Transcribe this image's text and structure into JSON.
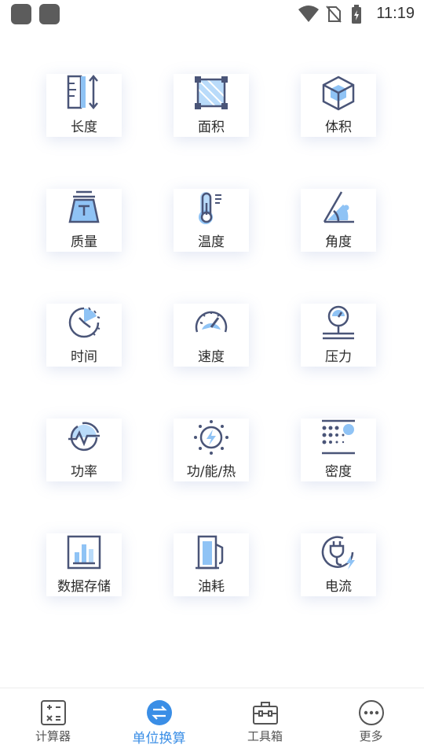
{
  "status_bar": {
    "time": "11:19"
  },
  "tiles": [
    {
      "label": "长度",
      "icon": "ruler-length-icon"
    },
    {
      "label": "面积",
      "icon": "area-square-icon"
    },
    {
      "label": "体积",
      "icon": "volume-cube-icon"
    },
    {
      "label": "质量",
      "icon": "weight-icon"
    },
    {
      "label": "温度",
      "icon": "thermometer-icon"
    },
    {
      "label": "角度",
      "icon": "angle-icon"
    },
    {
      "label": "时间",
      "icon": "clock-icon"
    },
    {
      "label": "速度",
      "icon": "speedometer-icon"
    },
    {
      "label": "压力",
      "icon": "pressure-gauge-icon"
    },
    {
      "label": "功率",
      "icon": "power-pulse-icon"
    },
    {
      "label": "功/能/热",
      "icon": "energy-bolt-icon"
    },
    {
      "label": "密度",
      "icon": "density-dots-icon"
    },
    {
      "label": "数据存储",
      "icon": "bar-chart-storage-icon"
    },
    {
      "label": "油耗",
      "icon": "fuel-pump-icon"
    },
    {
      "label": "电流",
      "icon": "plug-current-icon"
    }
  ],
  "bottom_nav": [
    {
      "label": "计算器",
      "icon": "calculator-icon",
      "active": false
    },
    {
      "label": "单位换算",
      "icon": "convert-arrows-icon",
      "active": true
    },
    {
      "label": "工具箱",
      "icon": "toolbox-icon",
      "active": false
    },
    {
      "label": "更多",
      "icon": "more-dots-icon",
      "active": false
    }
  ],
  "colors": {
    "accent": "#3a8ee6",
    "icon_dark": "#4a5578",
    "icon_light": "#8fc3f5"
  }
}
